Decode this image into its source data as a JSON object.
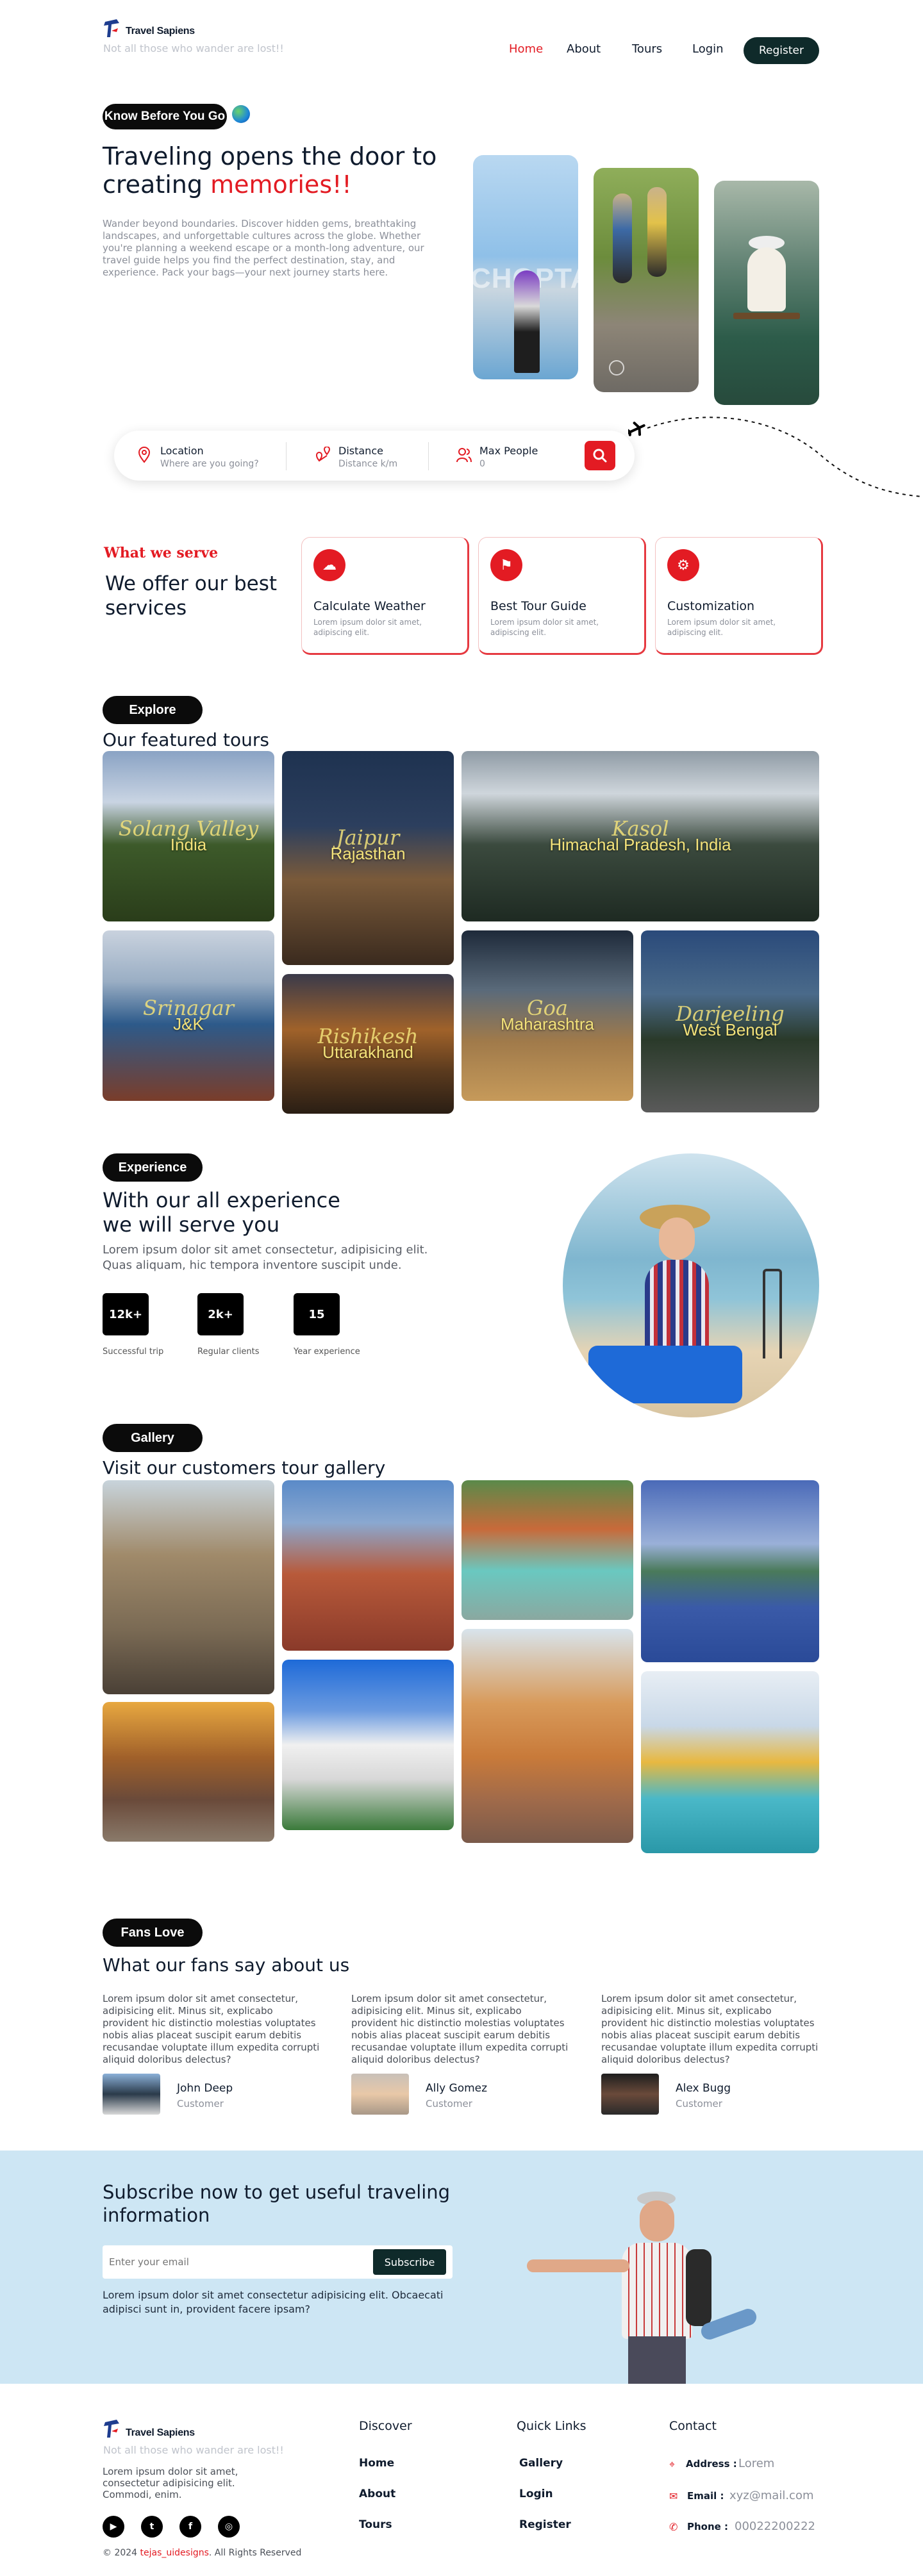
{
  "brand": {
    "name": "Travel Sapiens",
    "tagline": "Not all those who wander are lost!!"
  },
  "nav": {
    "items": [
      "Home",
      "About",
      "Tours",
      "Login"
    ],
    "active": "Home",
    "register": "Register"
  },
  "hero": {
    "badge": "Know Before You Go",
    "title_line1": "Traveling opens the door to",
    "title_line2_a": "creating ",
    "title_line2_b": "memories!!",
    "body": "Wander beyond boundaries. Discover hidden gems, breathtaking landscapes, and unforgettable cultures across the globe. Whether you're planning a weekend escape or a month-long adventure, our travel guide helps you find the perfect destination, stay, and experience. Pack your bags—your next journey starts here.",
    "photo_text": "CHOPTA"
  },
  "search": {
    "location_label": "Location",
    "location_value": "Where are you going?",
    "distance_label": "Distance",
    "distance_value": "Distance k/m",
    "people_label": "Max People",
    "people_value": "0"
  },
  "services": {
    "eyebrow": "What we serve",
    "title": "We offer our best services",
    "cards": [
      {
        "title": "Calculate Weather",
        "desc": "Lorem ipsum dolor sit amet, adipiscing elit."
      },
      {
        "title": "Best Tour Guide",
        "desc": "Lorem ipsum dolor sit amet, adipiscing elit."
      },
      {
        "title": "Customization",
        "desc": "Lorem ipsum dolor sit amet, adipiscing elit."
      }
    ]
  },
  "explore": {
    "badge": "Explore",
    "title": "Our featured tours",
    "tours": [
      {
        "script": "Solang Valley",
        "name": "India"
      },
      {
        "script": "Jaipur",
        "name": "Rajasthan"
      },
      {
        "script": "Kasol",
        "name": "Himachal Pradesh, India"
      },
      {
        "script": "Srinagar",
        "name": "J&K"
      },
      {
        "script": "Rishikesh",
        "name": "Uttarakhand"
      },
      {
        "script": "Goa",
        "name": "Maharashtra"
      },
      {
        "script": "Darjeeling",
        "name": "West Bengal"
      }
    ]
  },
  "experience": {
    "badge": "Experience",
    "title_line1": "With our all experience",
    "title_line2": "we will serve you",
    "body_line1": "Lorem ipsum dolor sit amet consectetur, adipisicing elit.",
    "body_line2": "Quas aliquam, hic tempora inventore suscipit unde.",
    "stats": [
      {
        "value": "12k+",
        "label": "Successful trip"
      },
      {
        "value": "2k+",
        "label": "Regular clients"
      },
      {
        "value": "15",
        "label": "Year experience"
      }
    ]
  },
  "gallery": {
    "badge": "Gallery",
    "title": "Visit our customers tour gallery"
  },
  "fans": {
    "badge": "Fans Love",
    "title": "What our fans say about us",
    "review": "Lorem ipsum dolor sit amet consectetur, adipisicing elit. Minus sit, explicabo provident hic distinctio molestias voluptates nobis alias placeat suscipit earum debitis recusandae voluptate illum expedita corrupti aliquid doloribus delectus?",
    "people": [
      {
        "name": "John Deep",
        "role": "Customer"
      },
      {
        "name": "Ally Gomez",
        "role": "Customer"
      },
      {
        "name": "Alex Bugg",
        "role": "Customer"
      }
    ]
  },
  "subscribe": {
    "title_line1": "Subscribe now to get useful traveling",
    "title_line2": "information",
    "placeholder": "Enter your email",
    "button": "Subscribe",
    "body_line1": "Lorem ipsum dolor sit amet consectetur adipisicing elit. Obcaecati",
    "body_line2": "adipisci sunt in, provident facere ipsam?"
  },
  "footer": {
    "desc_line1": "Lorem ipsum dolor sit amet,",
    "desc_line2": "consectetur adipisicing elit.",
    "desc_line3": "Commodi, enim.",
    "discover_title": "Discover",
    "discover": [
      "Home",
      "About",
      "Tours"
    ],
    "quick_title": "Quick Links",
    "quick": [
      "Gallery",
      "Login",
      "Register"
    ],
    "contact_title": "Contact",
    "address_label": "Address :",
    "address_value": "Lorem",
    "email_label": "Email :",
    "email_value": "xyz@mail.com",
    "phone_label": "Phone :",
    "phone_value": "00022200222",
    "copyright_a": "© 2024 ",
    "copyright_link": "tejas_uidesigns",
    "copyright_b": ". All Rights Reserved"
  },
  "colors": {
    "accent": "#e31b23",
    "dark": "#0f2a2a",
    "subscribe_bg": "#cde6f4"
  }
}
